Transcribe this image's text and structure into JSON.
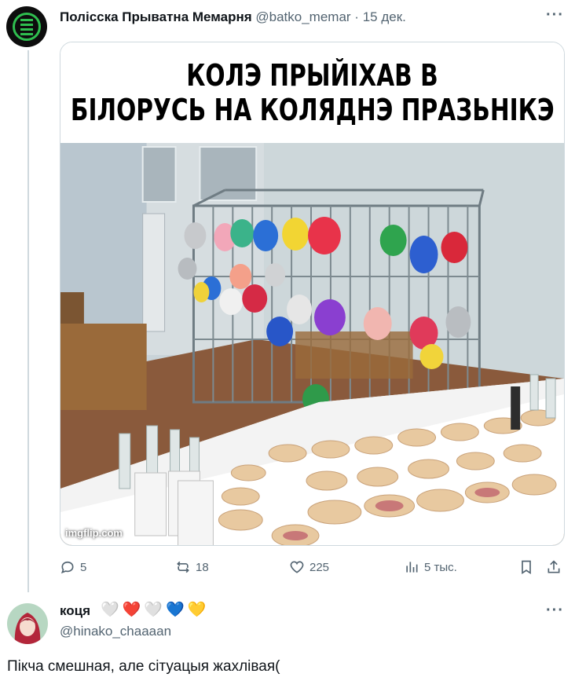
{
  "tweet": {
    "author_name": "Полісска Прыватна Мемарня",
    "author_handle": "@batko_memar",
    "separator": " · ",
    "date": "15 дек.",
    "more": "···",
    "media": {
      "caption_line1": "КОЛЭ ПРЫЙІХАВ В",
      "caption_line2": "БІЛОРУСЬ НА КОЛЯДНЭ ПРАЗЬНІКЭ",
      "watermark": "imgflip.com"
    },
    "stats": {
      "replies": "5",
      "retweets": "18",
      "likes": "225",
      "views": "5 тыс."
    }
  },
  "reply": {
    "author_name": "коця",
    "author_handle": "@hinako_chaaaan",
    "more": "···",
    "hearts": [
      "🤍",
      "❤️",
      "🤍",
      "💙",
      "💛"
    ],
    "text": "Пікча смешная, але сітуацыя жахлівая("
  },
  "colors": {
    "text": "#0f1419",
    "muted": "#536471",
    "border": "#cfd9de",
    "logo_green": "#2fbf4f"
  }
}
